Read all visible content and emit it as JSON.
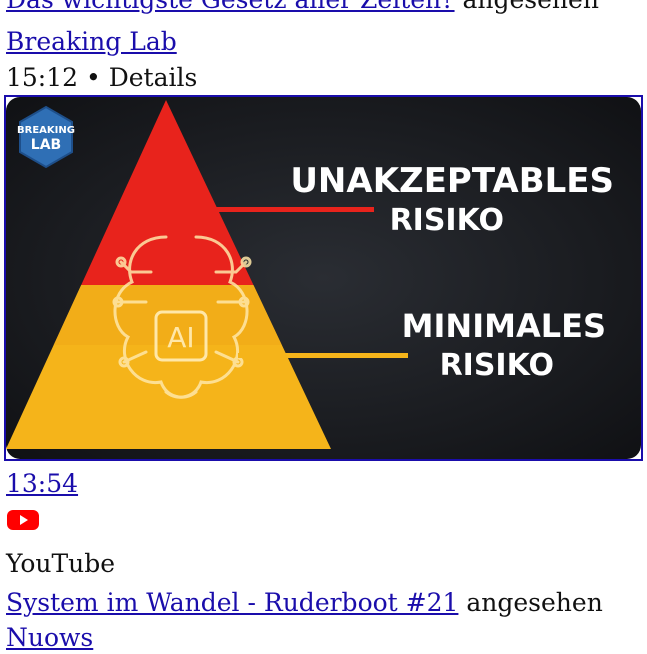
{
  "history": [
    {
      "video_title": "Das wichtigste Gesetz aller Zeiten?",
      "action": "angesehen",
      "channel": "Breaking Lab",
      "time": "15:12",
      "separator": "•",
      "details_label": "Details",
      "thumbnail": {
        "logo_line1": "BREAKING",
        "logo_line2": "LAB",
        "chip_label": "AI",
        "upper_label_line1": "UNAKZEPTABLES",
        "upper_label_line2": "RISIKO",
        "lower_label_line1": "MINIMALES",
        "lower_label_line2": "RISIKO"
      }
    },
    {
      "time_link": "13:54",
      "product_icon": "youtube-icon",
      "product": "YouTube",
      "video_title": "System im Wandel - Ruderboot #21",
      "action": "angesehen",
      "channel": "Nuows"
    }
  ],
  "colors": {
    "link": "#1a0dab",
    "youtube_red": "#ff0000",
    "pyramid_red": "#e8231c",
    "pyramid_yellow": "#f5b41a"
  }
}
